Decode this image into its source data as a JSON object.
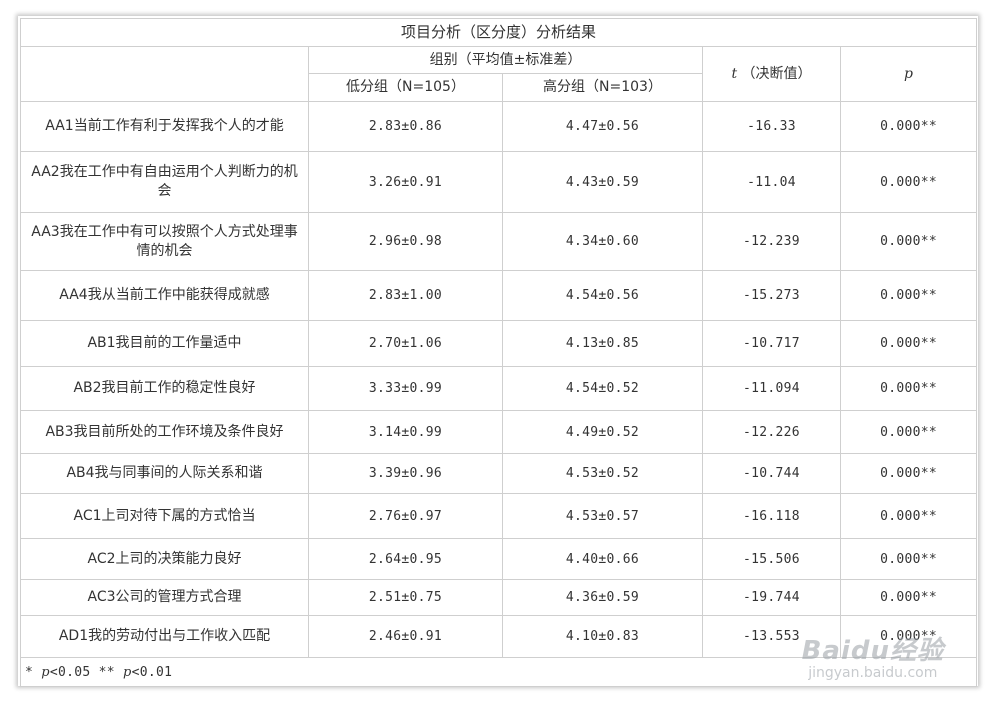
{
  "table": {
    "title": "项目分析（区分度）分析结果",
    "group_header": "组别（平均值±标准差）",
    "low_header": "低分组（N=105）",
    "high_header": "高分组（N=103）",
    "t_symbol": "t",
    "t_header": "（决断值）",
    "p_header": "p",
    "rows": [
      {
        "item": "AA1当前工作有利于发挥我个人的才能",
        "low": "2.83±0.86",
        "high": "4.47±0.56",
        "t": "-16.33",
        "p": "0.000**"
      },
      {
        "item": "AA2我在工作中有自由运用个人判断力的机会",
        "low": "3.26±0.91",
        "high": "4.43±0.59",
        "t": "-11.04",
        "p": "0.000**"
      },
      {
        "item": "AA3我在工作中有可以按照个人方式处理事情的机会",
        "low": "2.96±0.98",
        "high": "4.34±0.60",
        "t": "-12.239",
        "p": "0.000**"
      },
      {
        "item": "AA4我从当前工作中能获得成就感",
        "low": "2.83±1.00",
        "high": "4.54±0.56",
        "t": "-15.273",
        "p": "0.000**"
      },
      {
        "item": "AB1我目前的工作量适中",
        "low": "2.70±1.06",
        "high": "4.13±0.85",
        "t": "-10.717",
        "p": "0.000**"
      },
      {
        "item": "AB2我目前工作的稳定性良好",
        "low": "3.33±0.99",
        "high": "4.54±0.52",
        "t": "-11.094",
        "p": "0.000**"
      },
      {
        "item": "AB3我目前所处的工作环境及条件良好",
        "low": "3.14±0.99",
        "high": "4.49±0.52",
        "t": "-12.226",
        "p": "0.000**"
      },
      {
        "item": "AB4我与同事间的人际关系和谐",
        "low": "3.39±0.96",
        "high": "4.53±0.52",
        "t": "-10.744",
        "p": "0.000**"
      },
      {
        "item": "AC1上司对待下属的方式恰当",
        "low": "2.76±0.97",
        "high": "4.53±0.57",
        "t": "-16.118",
        "p": "0.000**"
      },
      {
        "item": "AC2上司的决策能力良好",
        "low": "2.64±0.95",
        "high": "4.40±0.66",
        "t": "-15.506",
        "p": "0.000**"
      },
      {
        "item": "AC3公司的管理方式合理",
        "low": "2.51±0.75",
        "high": "4.36±0.59",
        "t": "-19.744",
        "p": "0.000**"
      },
      {
        "item": "AD1我的劳动付出与工作收入匹配",
        "low": "2.46±0.91",
        "high": "4.10±0.83",
        "t": "-13.553",
        "p": "0.000**"
      }
    ],
    "note_a": "* ",
    "note_p1": "p",
    "note_b": "<0.05 ** ",
    "note_p2": "p",
    "note_c": "<0.01"
  },
  "watermark": {
    "logo": "Baidu经验",
    "url": "jingyan.baidu.com"
  }
}
